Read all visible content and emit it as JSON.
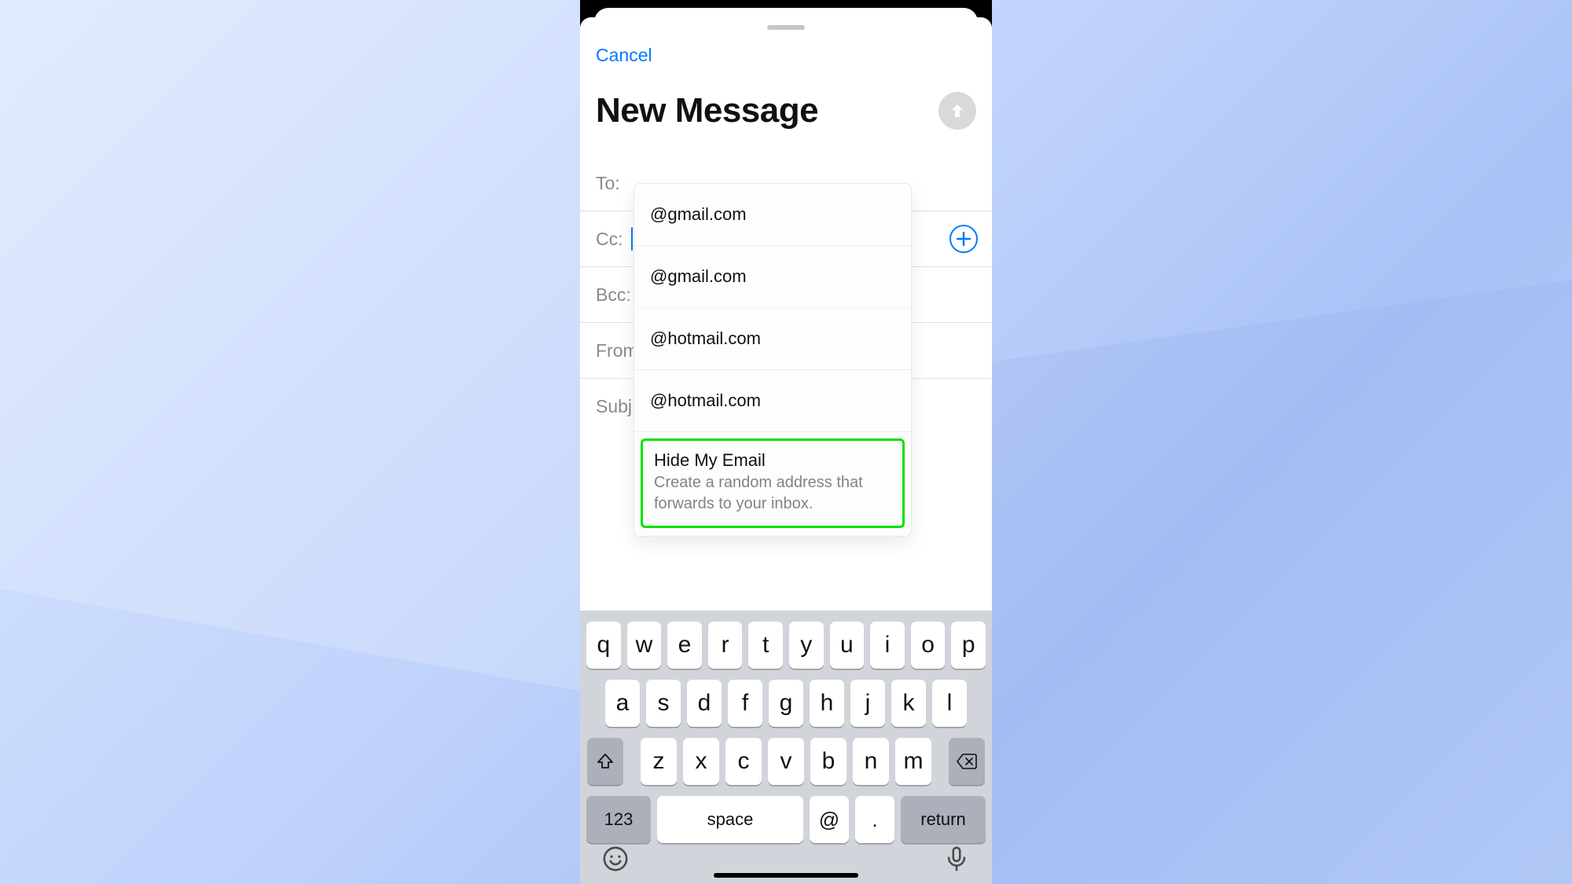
{
  "nav": {
    "cancel_label": "Cancel"
  },
  "compose": {
    "title": "New Message",
    "fields": {
      "to": "To:",
      "cc": "Cc:",
      "bcc": "Bcc:",
      "from": "From",
      "subject": "Subj"
    }
  },
  "suggestions": {
    "items": [
      "@gmail.com",
      "@gmail.com",
      "@hotmail.com",
      "@hotmail.com"
    ],
    "hide_my_email": {
      "title": "Hide My Email",
      "subtitle": "Create a random address that forwards to your inbox."
    }
  },
  "keyboard": {
    "row1": [
      "q",
      "w",
      "e",
      "r",
      "t",
      "y",
      "u",
      "i",
      "o",
      "p"
    ],
    "row2": [
      "a",
      "s",
      "d",
      "f",
      "g",
      "h",
      "j",
      "k",
      "l"
    ],
    "row3": [
      "z",
      "x",
      "c",
      "v",
      "b",
      "n",
      "m"
    ],
    "label_123": "123",
    "label_space": "space",
    "label_at": "@",
    "label_dot": ".",
    "label_return": "return"
  }
}
